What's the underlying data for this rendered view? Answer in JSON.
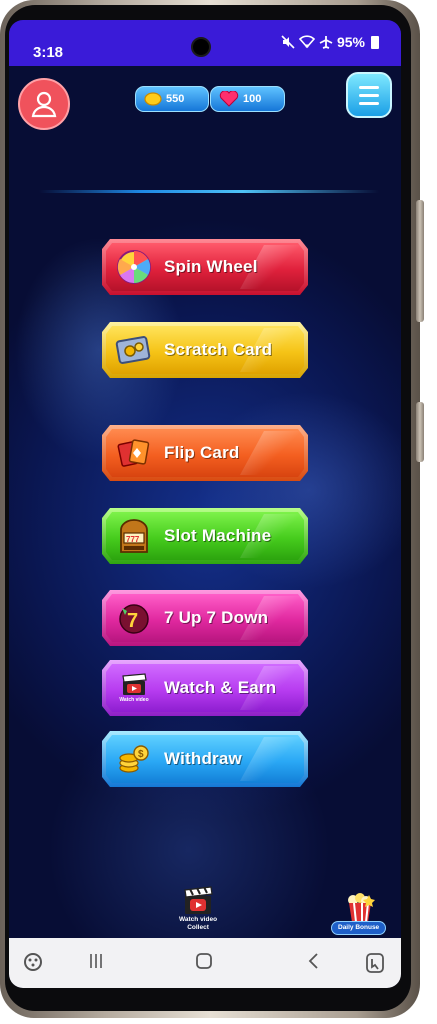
{
  "status_bar": {
    "time": "3:18",
    "battery_text": "95%"
  },
  "header": {
    "coins": {
      "value": "550",
      "icon": "coin-icon"
    },
    "hearts": {
      "value": "100",
      "icon": "heart-icon"
    },
    "profile_icon": "user-icon",
    "menu_icon": "hamburger-icon"
  },
  "menu": {
    "items": [
      {
        "label": "Spin Wheel",
        "icon": "wheel-icon",
        "color": "#e0213c"
      },
      {
        "label": "Scratch Card",
        "icon": "scratch-card-icon",
        "color": "#f5c316"
      },
      {
        "label": "Flip Card",
        "icon": "cards-icon",
        "color": "#f45f20"
      },
      {
        "label": "Slot Machine",
        "icon": "slot-machine-icon",
        "color": "#46cc1d"
      },
      {
        "label": "7 Up 7 Down",
        "icon": "seven-ball-icon",
        "color": "#e0289f"
      },
      {
        "label": "Watch & Earn",
        "icon": "clapperboard-icon",
        "color": "#b73cf0",
        "icon_caption": "Watch video"
      },
      {
        "label": "Withdraw",
        "icon": "coins-stack-icon",
        "color": "#2aa8f5"
      }
    ]
  },
  "bottom": {
    "watch_video": {
      "line1": "Watch video",
      "line2": "Collect"
    },
    "daily_bonus": {
      "label": "Daily Bonuse"
    }
  },
  "colors": {
    "status_bar": "#3a1bd8",
    "background": "#0a1650",
    "profile_button": "#f0525c",
    "menu_button": "#1a9fe6"
  }
}
